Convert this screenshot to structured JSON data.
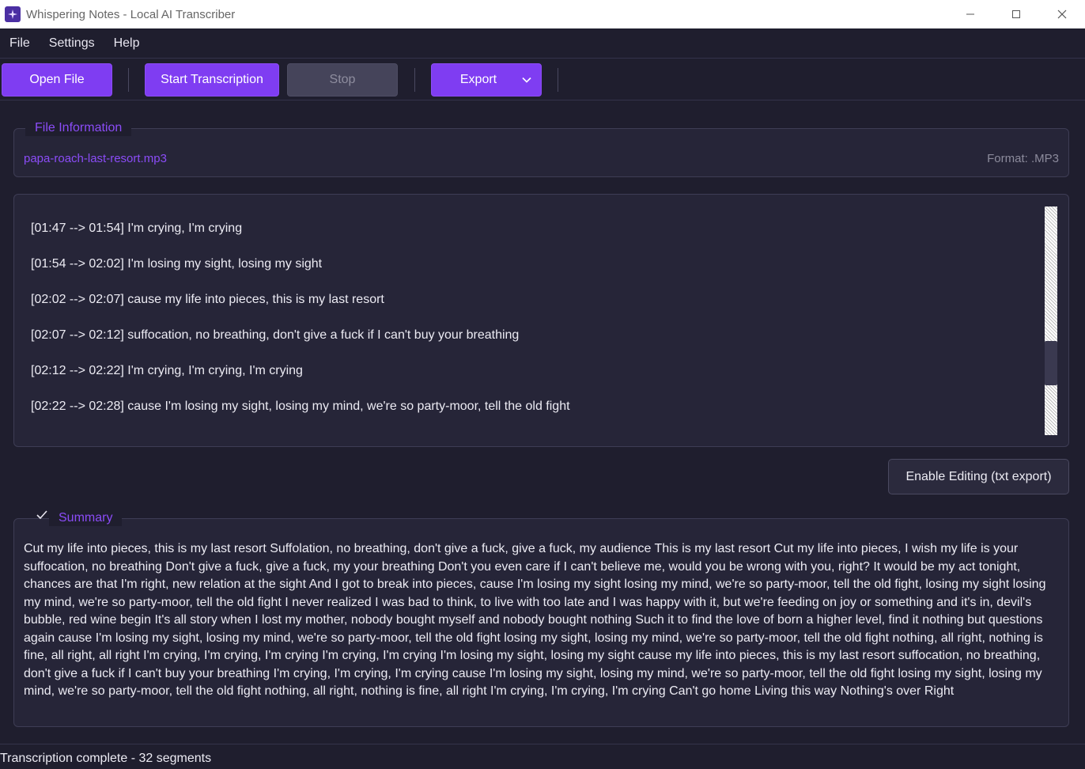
{
  "window": {
    "title": "Whispering Notes - Local AI Transcriber",
    "icon": "app-logo-icon",
    "controls": [
      "minimize-icon",
      "maximize-icon",
      "close-icon"
    ]
  },
  "menu": {
    "file": "File",
    "settings": "Settings",
    "help": "Help"
  },
  "toolbar": {
    "open_file": "Open File",
    "start_transcription": "Start Transcription",
    "stop": "Stop",
    "export": "Export",
    "accent_color": "#7f3df2"
  },
  "file_info": {
    "title": "File Information",
    "file_name": "papa-roach-last-resort.mp3",
    "format": "Format: .MP3"
  },
  "transcript": {
    "segments": [
      "[01:47 --> 01:54] I'm crying, I'm crying",
      "[01:54 --> 02:02] I'm losing my sight, losing my sight",
      "[02:02 --> 02:07] cause my life into pieces, this is my last resort",
      "[02:07 --> 02:12] suffocation, no breathing, don't give a fuck if I can't buy your breathing",
      "[02:12 --> 02:22] I'm crying, I'm crying, I'm crying",
      "[02:22 --> 02:28] cause I'm losing my sight, losing my mind, we're so party-moor, tell the old fight"
    ]
  },
  "editing": {
    "enable_label": "Enable Editing (txt export)"
  },
  "summary": {
    "title": "Summary",
    "checked": true,
    "text": "Cut my life into pieces, this is my last resort Suffolation, no breathing, don't give a fuck, give a fuck, my audience This is my last resort Cut my life into pieces, I wish my life is your suffocation, no breathing Don't give a fuck, give a fuck, my your breathing Don't you even care if I can't believe me, would you be wrong with you, right? It would be my act tonight, chances are that I'm right, new relation at the sight And I got to break into pieces, cause I'm losing my sight losing my mind, we're so party-moor, tell the old fight, losing my sight losing my mind, we're so party-moor, tell the old fight I never realized I was bad to think, to live with too late and I was happy with it, but we're feeding on joy or something and it's in, devil's bubble, red wine begin It's all story when I lost my mother, nobody bought myself and nobody bought nothing Such it to find the love of born a higher level, find it nothing but questions again cause I'm losing my sight, losing my mind, we're so party-moor, tell the old fight losing my sight, losing my mind, we're so party-moor, tell the old fight nothing, all right, nothing is fine, all right, all right I'm crying, I'm crying, I'm crying I'm crying, I'm crying I'm losing my sight, losing my sight cause my life into pieces, this is my last resort suffocation, no breathing, don't give a fuck if I can't buy your breathing I'm crying, I'm crying, I'm crying cause I'm losing my sight, losing my mind, we're so party-moor, tell the old fight losing my sight, losing my mind, we're so party-moor, tell the old fight nothing, all right, nothing is fine, all right I'm crying, I'm crying, I'm crying Can't go home Living this way Nothing's over Right"
  },
  "status": {
    "text": "Transcription complete - 32 segments"
  }
}
